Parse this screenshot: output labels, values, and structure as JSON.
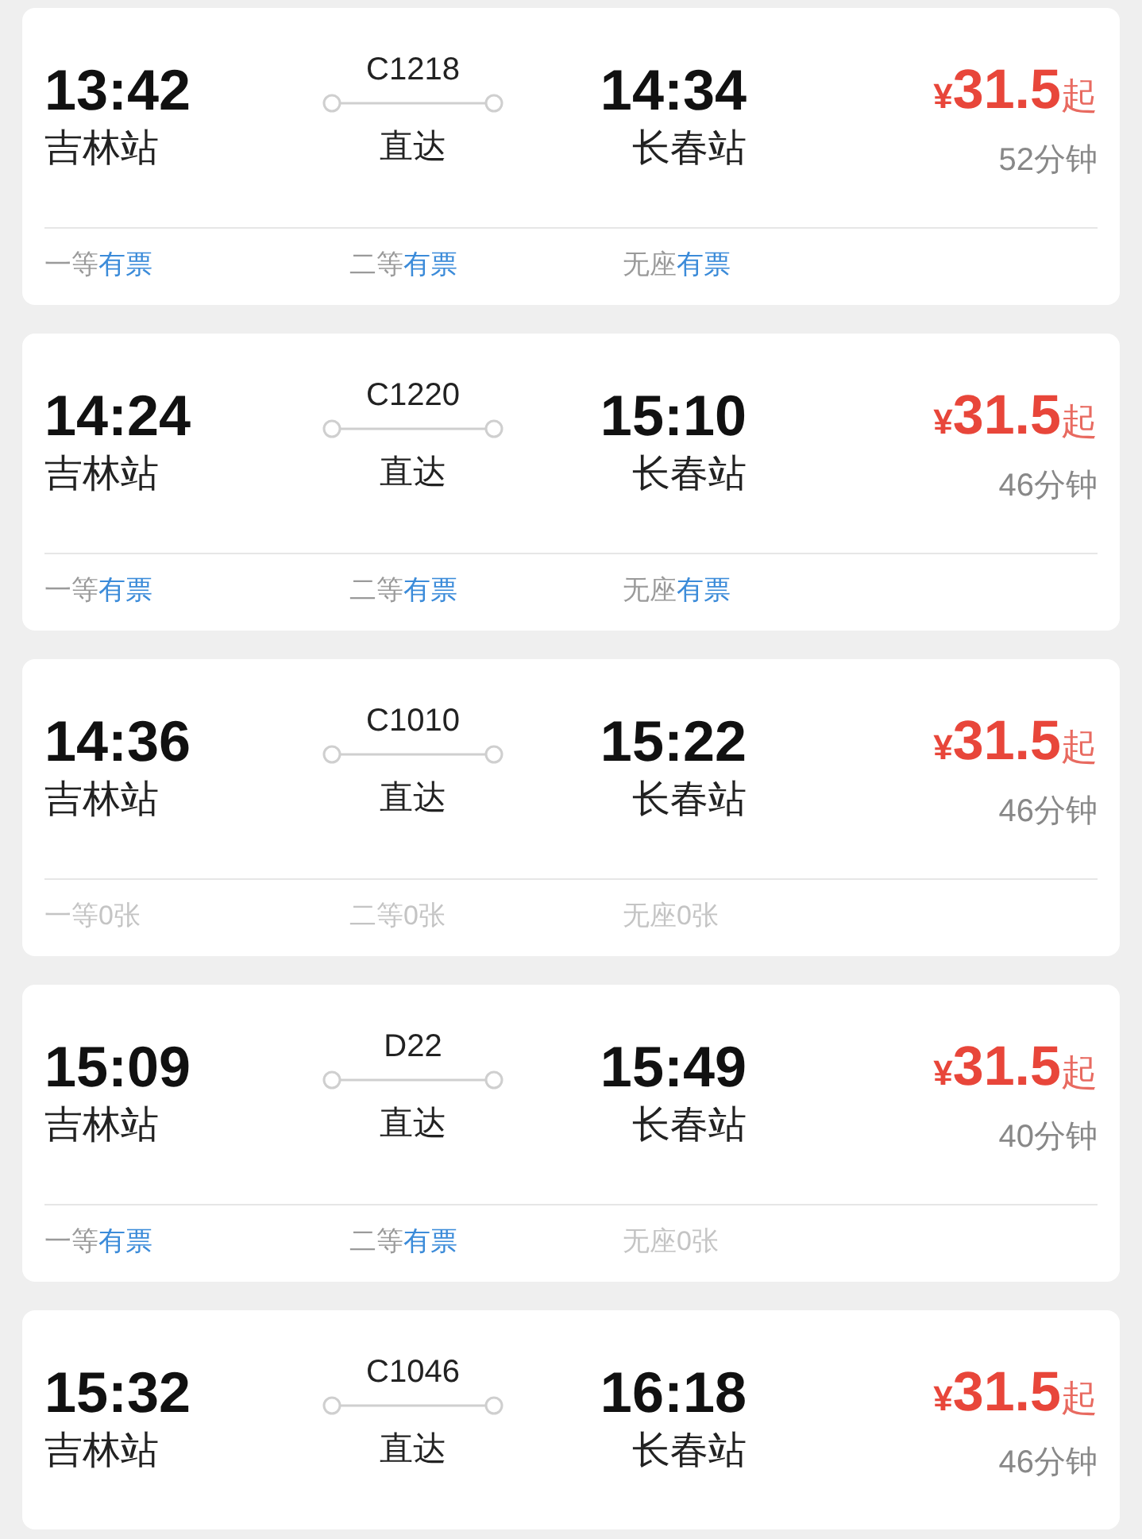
{
  "trains": [
    {
      "departure_time": "13:42",
      "departure_station": "吉林站",
      "train_number": "C1218",
      "route_type": "直达",
      "arrival_time": "14:34",
      "arrival_station": "长春站",
      "price": {
        "currency": "¥",
        "amount": "31.5",
        "suffix": "起"
      },
      "duration": "52分钟",
      "seats": [
        {
          "class": "一等",
          "status": "有票",
          "available": true
        },
        {
          "class": "二等",
          "status": "有票",
          "available": true
        },
        {
          "class": "无座",
          "status": "有票",
          "available": true
        }
      ]
    },
    {
      "departure_time": "14:24",
      "departure_station": "吉林站",
      "train_number": "C1220",
      "route_type": "直达",
      "arrival_time": "15:10",
      "arrival_station": "长春站",
      "price": {
        "currency": "¥",
        "amount": "31.5",
        "suffix": "起"
      },
      "duration": "46分钟",
      "seats": [
        {
          "class": "一等",
          "status": "有票",
          "available": true
        },
        {
          "class": "二等",
          "status": "有票",
          "available": true
        },
        {
          "class": "无座",
          "status": "有票",
          "available": true
        }
      ]
    },
    {
      "departure_time": "14:36",
      "departure_station": "吉林站",
      "train_number": "C1010",
      "route_type": "直达",
      "arrival_time": "15:22",
      "arrival_station": "长春站",
      "price": {
        "currency": "¥",
        "amount": "31.5",
        "suffix": "起"
      },
      "duration": "46分钟",
      "seats": [
        {
          "class": "一等",
          "status": "0张",
          "available": false
        },
        {
          "class": "二等",
          "status": "0张",
          "available": false
        },
        {
          "class": "无座",
          "status": "0张",
          "available": false
        }
      ]
    },
    {
      "departure_time": "15:09",
      "departure_station": "吉林站",
      "train_number": "D22",
      "route_type": "直达",
      "arrival_time": "15:49",
      "arrival_station": "长春站",
      "price": {
        "currency": "¥",
        "amount": "31.5",
        "suffix": "起"
      },
      "duration": "40分钟",
      "seats": [
        {
          "class": "一等",
          "status": "有票",
          "available": true
        },
        {
          "class": "二等",
          "status": "有票",
          "available": true
        },
        {
          "class": "无座",
          "status": "0张",
          "available": false
        }
      ]
    },
    {
      "departure_time": "15:32",
      "departure_station": "吉林站",
      "train_number": "C1046",
      "route_type": "直达",
      "arrival_time": "16:18",
      "arrival_station": "长春站",
      "price": {
        "currency": "¥",
        "amount": "31.5",
        "suffix": "起"
      },
      "duration": "46分钟"
    }
  ]
}
